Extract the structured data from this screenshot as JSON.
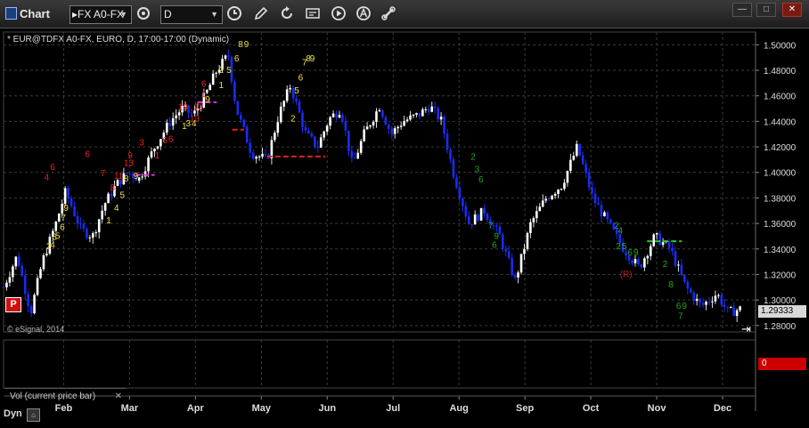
{
  "window": {
    "title": "Chart",
    "symbol_input": "▸FX A0-FX",
    "timeframe_input": "D",
    "controls": [
      "—",
      "□",
      "✕"
    ]
  },
  "chart": {
    "subtitle": "* EUR@TDFX A0-FX, EURO, D, 17:00-17:00 (Dynamic)",
    "copyright": "© eSignal, 2014",
    "last_price": "1.29333",
    "p_badge": "P",
    "r_marker": "(R)",
    "colors": {
      "up": "#ffffff",
      "down": "#1a2cf0",
      "grid": "#3a3a3a",
      "red_line": "#e02020",
      "magenta_line": "#e030e0",
      "green_line": "#22cc22",
      "setup_yellow": "#f0e040",
      "countdown_red": "#ee2020",
      "countdown_green": "#22aa22"
    }
  },
  "chart_data": {
    "type": "candlestick",
    "y_ticks": [
      "1.28000",
      "1.30000",
      "1.32000",
      "1.34000",
      "1.36000",
      "1.38000",
      "1.40000",
      "1.42000",
      "1.44000",
      "1.46000",
      "1.48000",
      "1.50000"
    ],
    "ylim": [
      1.275,
      1.51
    ],
    "x_ticks": [
      "Feb",
      "Mar",
      "Apr",
      "May",
      "Jun",
      "Jul",
      "Aug",
      "Sep",
      "Oct",
      "Nov",
      "Dec"
    ],
    "months_plotted": 12,
    "price_path": [
      [
        0,
        1.31
      ],
      [
        0.35,
        1.335
      ],
      [
        0.7,
        1.29
      ],
      [
        1.0,
        1.33
      ],
      [
        1.35,
        1.36
      ],
      [
        1.6,
        1.385
      ],
      [
        2.0,
        1.355
      ],
      [
        2.3,
        1.35
      ],
      [
        2.6,
        1.375
      ],
      [
        2.9,
        1.39
      ],
      [
        3.2,
        1.4
      ],
      [
        3.5,
        1.395
      ],
      [
        3.9,
        1.42
      ],
      [
        4.3,
        1.44
      ],
      [
        4.6,
        1.45
      ],
      [
        4.9,
        1.445
      ],
      [
        5.2,
        1.46
      ],
      [
        5.5,
        1.48
      ],
      [
        5.8,
        1.492
      ],
      [
        6.0,
        1.45
      ],
      [
        6.4,
        1.415
      ],
      [
        6.8,
        1.41
      ],
      [
        7.1,
        1.445
      ],
      [
        7.4,
        1.468
      ],
      [
        7.8,
        1.43
      ],
      [
        8.1,
        1.42
      ],
      [
        8.4,
        1.442
      ],
      [
        8.7,
        1.45
      ],
      [
        9.0,
        1.405
      ],
      [
        9.3,
        1.43
      ],
      [
        9.7,
        1.452
      ],
      [
        10.0,
        1.43
      ],
      [
        10.3,
        1.44
      ],
      [
        10.7,
        1.445
      ],
      [
        11.0,
        1.452
      ],
      [
        11.3,
        1.44
      ],
      [
        11.6,
        1.4
      ],
      [
        12.0,
        1.36
      ],
      [
        12.4,
        1.37
      ],
      [
        12.8,
        1.35
      ],
      [
        13.2,
        1.315
      ],
      [
        13.6,
        1.36
      ],
      [
        14.0,
        1.38
      ],
      [
        14.4,
        1.39
      ],
      [
        14.8,
        1.42
      ],
      [
        15.2,
        1.38
      ],
      [
        15.6,
        1.36
      ],
      [
        16.0,
        1.34
      ],
      [
        16.4,
        1.325
      ],
      [
        16.8,
        1.35
      ],
      [
        17.2,
        1.34
      ],
      [
        17.6,
        1.31
      ],
      [
        18.0,
        1.295
      ],
      [
        18.4,
        1.305
      ],
      [
        18.7,
        1.29
      ],
      [
        19.0,
        1.293
      ]
    ],
    "horizontal_levels": [
      {
        "name": "red-resistance",
        "y": 1.4335,
        "x_range": [
          5.9,
          6.2
        ],
        "color": "red_line"
      },
      {
        "name": "red-support",
        "y": 1.4125,
        "x_range": [
          6.8,
          8.3
        ],
        "color": "red_line"
      },
      {
        "name": "magenta-level",
        "y": 1.455,
        "x_range": [
          5.0,
          5.5
        ],
        "color": "magenta_line"
      },
      {
        "name": "magenta-level-2",
        "y": 1.398,
        "x_range": [
          3.4,
          3.9
        ],
        "color": "magenta_line"
      },
      {
        "name": "green-level",
        "y": 1.346,
        "x_range": [
          16.6,
          17.5
        ],
        "color": "green_line"
      }
    ],
    "td_labels_setup": [
      {
        "t": "2",
        "x": 1.1,
        "y": 1.34
      },
      {
        "t": "4",
        "x": 1.2,
        "y": 1.341
      },
      {
        "t": "3",
        "x": 1.25,
        "y": 1.347
      },
      {
        "t": "5",
        "x": 1.33,
        "y": 1.348
      },
      {
        "t": "6",
        "x": 1.45,
        "y": 1.355
      },
      {
        "t": "7",
        "x": 1.48,
        "y": 1.362
      },
      {
        "t": "9",
        "x": 1.55,
        "y": 1.37
      },
      {
        "t": "1",
        "x": 2.65,
        "y": 1.36
      },
      {
        "t": "4",
        "x": 2.85,
        "y": 1.37
      },
      {
        "t": "5",
        "x": 3.0,
        "y": 1.38
      },
      {
        "t": "8",
        "x": 3.1,
        "y": 1.393
      },
      {
        "t": "9",
        "x": 3.35,
        "y": 1.395
      },
      {
        "t": "1",
        "x": 4.6,
        "y": 1.434
      },
      {
        "t": "3",
        "x": 4.7,
        "y": 1.436
      },
      {
        "t": "4",
        "x": 4.85,
        "y": 1.436
      },
      {
        "t": "9",
        "x": 5.2,
        "y": 1.455
      },
      {
        "t": "1",
        "x": 5.55,
        "y": 1.466
      },
      {
        "t": "2",
        "x": 5.55,
        "y": 1.478
      },
      {
        "t": "5",
        "x": 5.75,
        "y": 1.478
      },
      {
        "t": "6",
        "x": 5.95,
        "y": 1.487
      },
      {
        "t": "8",
        "x": 6.05,
        "y": 1.498
      },
      {
        "t": "9",
        "x": 6.2,
        "y": 1.498
      },
      {
        "t": "2",
        "x": 7.4,
        "y": 1.44
      },
      {
        "t": "5",
        "x": 7.5,
        "y": 1.462
      },
      {
        "t": "6",
        "x": 7.6,
        "y": 1.472
      },
      {
        "t": "7",
        "x": 7.7,
        "y": 1.484
      },
      {
        "t": "8",
        "x": 7.8,
        "y": 1.487
      },
      {
        "t": "9",
        "x": 7.9,
        "y": 1.487
      }
    ],
    "td_labels_countdown_red": [
      {
        "t": "4",
        "x": 1.05,
        "y": 1.394
      },
      {
        "t": "6",
        "x": 1.2,
        "y": 1.402
      },
      {
        "t": "6",
        "x": 2.1,
        "y": 1.412
      },
      {
        "t": "7",
        "x": 2.5,
        "y": 1.397
      },
      {
        "t": "8",
        "x": 2.75,
        "y": 1.386
      },
      {
        "t": "11",
        "x": 2.85,
        "y": 1.395
      },
      {
        "t": "13",
        "x": 3.1,
        "y": 1.405
      },
      {
        "t": "9",
        "x": 3.2,
        "y": 1.411
      },
      {
        "t": "3",
        "x": 3.5,
        "y": 1.421
      },
      {
        "t": "1",
        "x": 3.9,
        "y": 1.411
      },
      {
        "t": "6",
        "x": 4.1,
        "y": 1.423
      },
      {
        "t": "6",
        "x": 4.25,
        "y": 1.424
      },
      {
        "t": "19",
        "x": 4.5,
        "y": 1.449
      },
      {
        "t": "12",
        "x": 4.9,
        "y": 1.449
      },
      {
        "t": "13",
        "x": 4.8,
        "y": 1.44
      },
      {
        "t": "1",
        "x": 5.1,
        "y": 1.459
      },
      {
        "t": "6",
        "x": 5.1,
        "y": 1.467
      }
    ],
    "td_labels_countdown_green": [
      {
        "t": "2",
        "x": 12.05,
        "y": 1.41
      },
      {
        "t": "3",
        "x": 12.15,
        "y": 1.4
      },
      {
        "t": "6",
        "x": 12.25,
        "y": 1.392
      },
      {
        "t": "7",
        "x": 12.5,
        "y": 1.356
      },
      {
        "t": "9",
        "x": 12.65,
        "y": 1.348
      },
      {
        "t": "6",
        "x": 12.6,
        "y": 1.341
      },
      {
        "t": "2",
        "x": 15.75,
        "y": 1.356
      },
      {
        "t": "4",
        "x": 15.85,
        "y": 1.352
      },
      {
        "t": "2",
        "x": 15.8,
        "y": 1.34
      },
      {
        "t": "5",
        "x": 15.95,
        "y": 1.34
      },
      {
        "t": "6",
        "x": 16.1,
        "y": 1.335
      },
      {
        "t": "9",
        "x": 16.25,
        "y": 1.335
      },
      {
        "t": "2",
        "x": 17.0,
        "y": 1.326
      },
      {
        "t": "8",
        "x": 17.15,
        "y": 1.31
      },
      {
        "t": "6",
        "x": 17.35,
        "y": 1.293
      },
      {
        "t": "9",
        "x": 17.5,
        "y": 1.293
      },
      {
        "t": "7",
        "x": 17.4,
        "y": 1.285
      }
    ]
  },
  "volume_pane": {
    "tab_label": "Vol (current price bar)",
    "tab_close": "✕",
    "value_tag": "0"
  },
  "footer": {
    "dyn_label": "Dyn",
    "dyn_icon_label": "⌂"
  }
}
